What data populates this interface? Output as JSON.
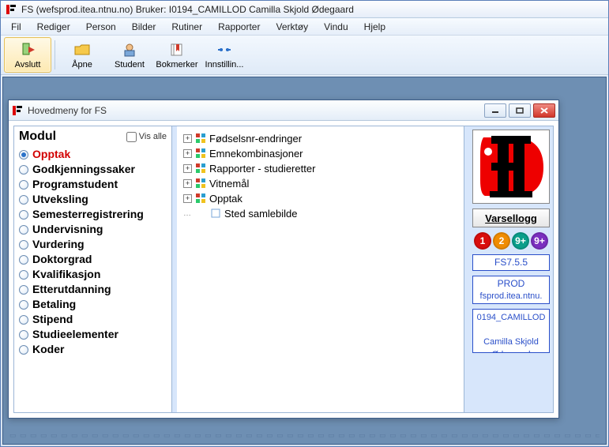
{
  "app": {
    "title": "FS (wefsprod.itea.ntnu.no) Bruker: I0194_CAMILLOD Camilla Skjold Ødegaard"
  },
  "menu": {
    "items": [
      "Fil",
      "Rediger",
      "Person",
      "Bilder",
      "Rutiner",
      "Rapporter",
      "Verktøy",
      "Vindu",
      "Hjelp"
    ]
  },
  "toolbar": {
    "items": [
      {
        "id": "avslutt",
        "label": "Avslutt",
        "selected": true
      },
      {
        "id": "apne",
        "label": "Åpne",
        "selected": false
      },
      {
        "id": "student",
        "label": "Student",
        "selected": false
      },
      {
        "id": "bokmerker",
        "label": "Bokmerker",
        "selected": false
      },
      {
        "id": "innstillin",
        "label": "Innstillin...",
        "selected": false
      }
    ]
  },
  "inner": {
    "title": "Hovedmeny for FS",
    "modul_title": "Modul",
    "vis_alle": "Vis alle",
    "modules": [
      "Opptak",
      "Godkjenningssaker",
      "Programstudent",
      "Utveksling",
      "Semesterregistrering",
      "Undervisning",
      "Vurdering",
      "Doktorgrad",
      "Kvalifikasjon",
      "Etterutdanning",
      "Betaling",
      "Stipend",
      "Studieelementer",
      "Koder"
    ],
    "module_selected": 0,
    "tree": [
      {
        "label": "Fødselsnr-endringer",
        "leaf": false
      },
      {
        "label": "Emnekombinasjoner",
        "leaf": false
      },
      {
        "label": "Rapporter - studieretter",
        "leaf": false
      },
      {
        "label": "Vitnemål",
        "leaf": false
      },
      {
        "label": "Opptak",
        "leaf": false
      },
      {
        "label": "Sted samlebilde",
        "leaf": true
      }
    ],
    "right": {
      "varsellogg": "Varsellogg",
      "badges": [
        {
          "text": "1",
          "color": "#d90d0d"
        },
        {
          "text": "2",
          "color": "#f08c00"
        },
        {
          "text": "9+",
          "color": "#0a9e8b"
        },
        {
          "text": "9+",
          "color": "#7b2fbf"
        }
      ],
      "version": "FS7.5.5",
      "env1": "PROD",
      "env2": "fsprod.itea.ntnu.",
      "user1": "0194_CAMILLOD",
      "user2": "Camilla Skjold Ødegaard"
    }
  }
}
